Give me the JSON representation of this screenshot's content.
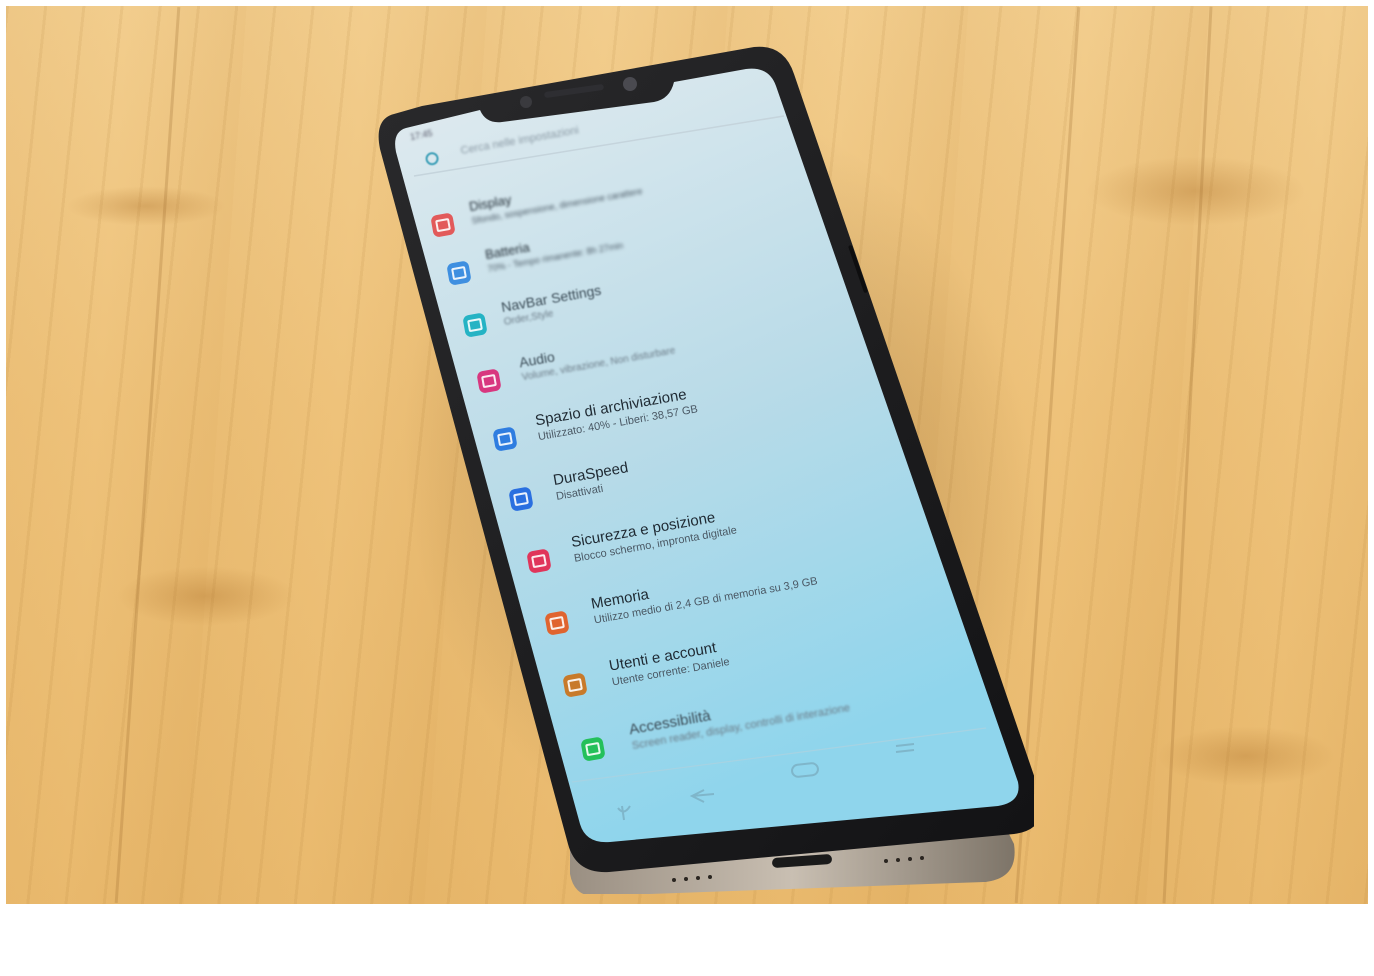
{
  "status_bar": {
    "time": "17:45"
  },
  "search": {
    "placeholder": "Cerca nelle impostazioni"
  },
  "settings_items": [
    {
      "id": "display",
      "title": "Display",
      "subtitle": "Sfondo, sospensione, dimensione carattere",
      "icon": "display-icon",
      "color": "#e25a5a"
    },
    {
      "id": "battery",
      "title": "Batteria",
      "subtitle": "70% - Tempo rimanente: 8h 27min",
      "icon": "battery-icon",
      "color": "#3f8fe0"
    },
    {
      "id": "navbar",
      "title": "NavBar Settings",
      "subtitle": "Order,Style",
      "icon": "navbar-icon",
      "color": "#25b3c4"
    },
    {
      "id": "audio",
      "title": "Audio",
      "subtitle": "Volume, vibrazione, Non disturbare",
      "icon": "audio-icon",
      "color": "#d8377f"
    },
    {
      "id": "storage",
      "title": "Spazio di archiviazione",
      "subtitle": "Utilizzato: 40% - Liberi: 38,57 GB",
      "icon": "storage-icon",
      "color": "#2f7de0"
    },
    {
      "id": "duraspeed",
      "title": "DuraSpeed",
      "subtitle": "Disattivati",
      "icon": "rocket-icon",
      "color": "#2a6fe0"
    },
    {
      "id": "security",
      "title": "Sicurezza e posizione",
      "subtitle": "Blocco schermo, impronta digitale",
      "icon": "lock-icon",
      "color": "#e0355a"
    },
    {
      "id": "memory",
      "title": "Memoria",
      "subtitle": "Utilizzo medio di 2,4 GB di memoria su 3,9 GB",
      "icon": "memory-icon",
      "color": "#e0642f"
    },
    {
      "id": "users",
      "title": "Utenti e account",
      "subtitle": "Utente corrente: Daniele",
      "icon": "user-icon",
      "color": "#c87a2a"
    },
    {
      "id": "accessibility",
      "title": "Accessibilità",
      "subtitle": "Screen reader, display, controlli di interazione",
      "icon": "accessibility-icon",
      "color": "#24c05a"
    }
  ],
  "nav_bar": {
    "icons": [
      "mic-icon",
      "back-icon",
      "home-icon",
      "recents-icon"
    ]
  },
  "colors": {
    "screen_top": "#dfe9ee",
    "screen_bottom": "#8fd3ea",
    "wood": "#eec27a",
    "phone_frame": "#1c1c1e"
  }
}
